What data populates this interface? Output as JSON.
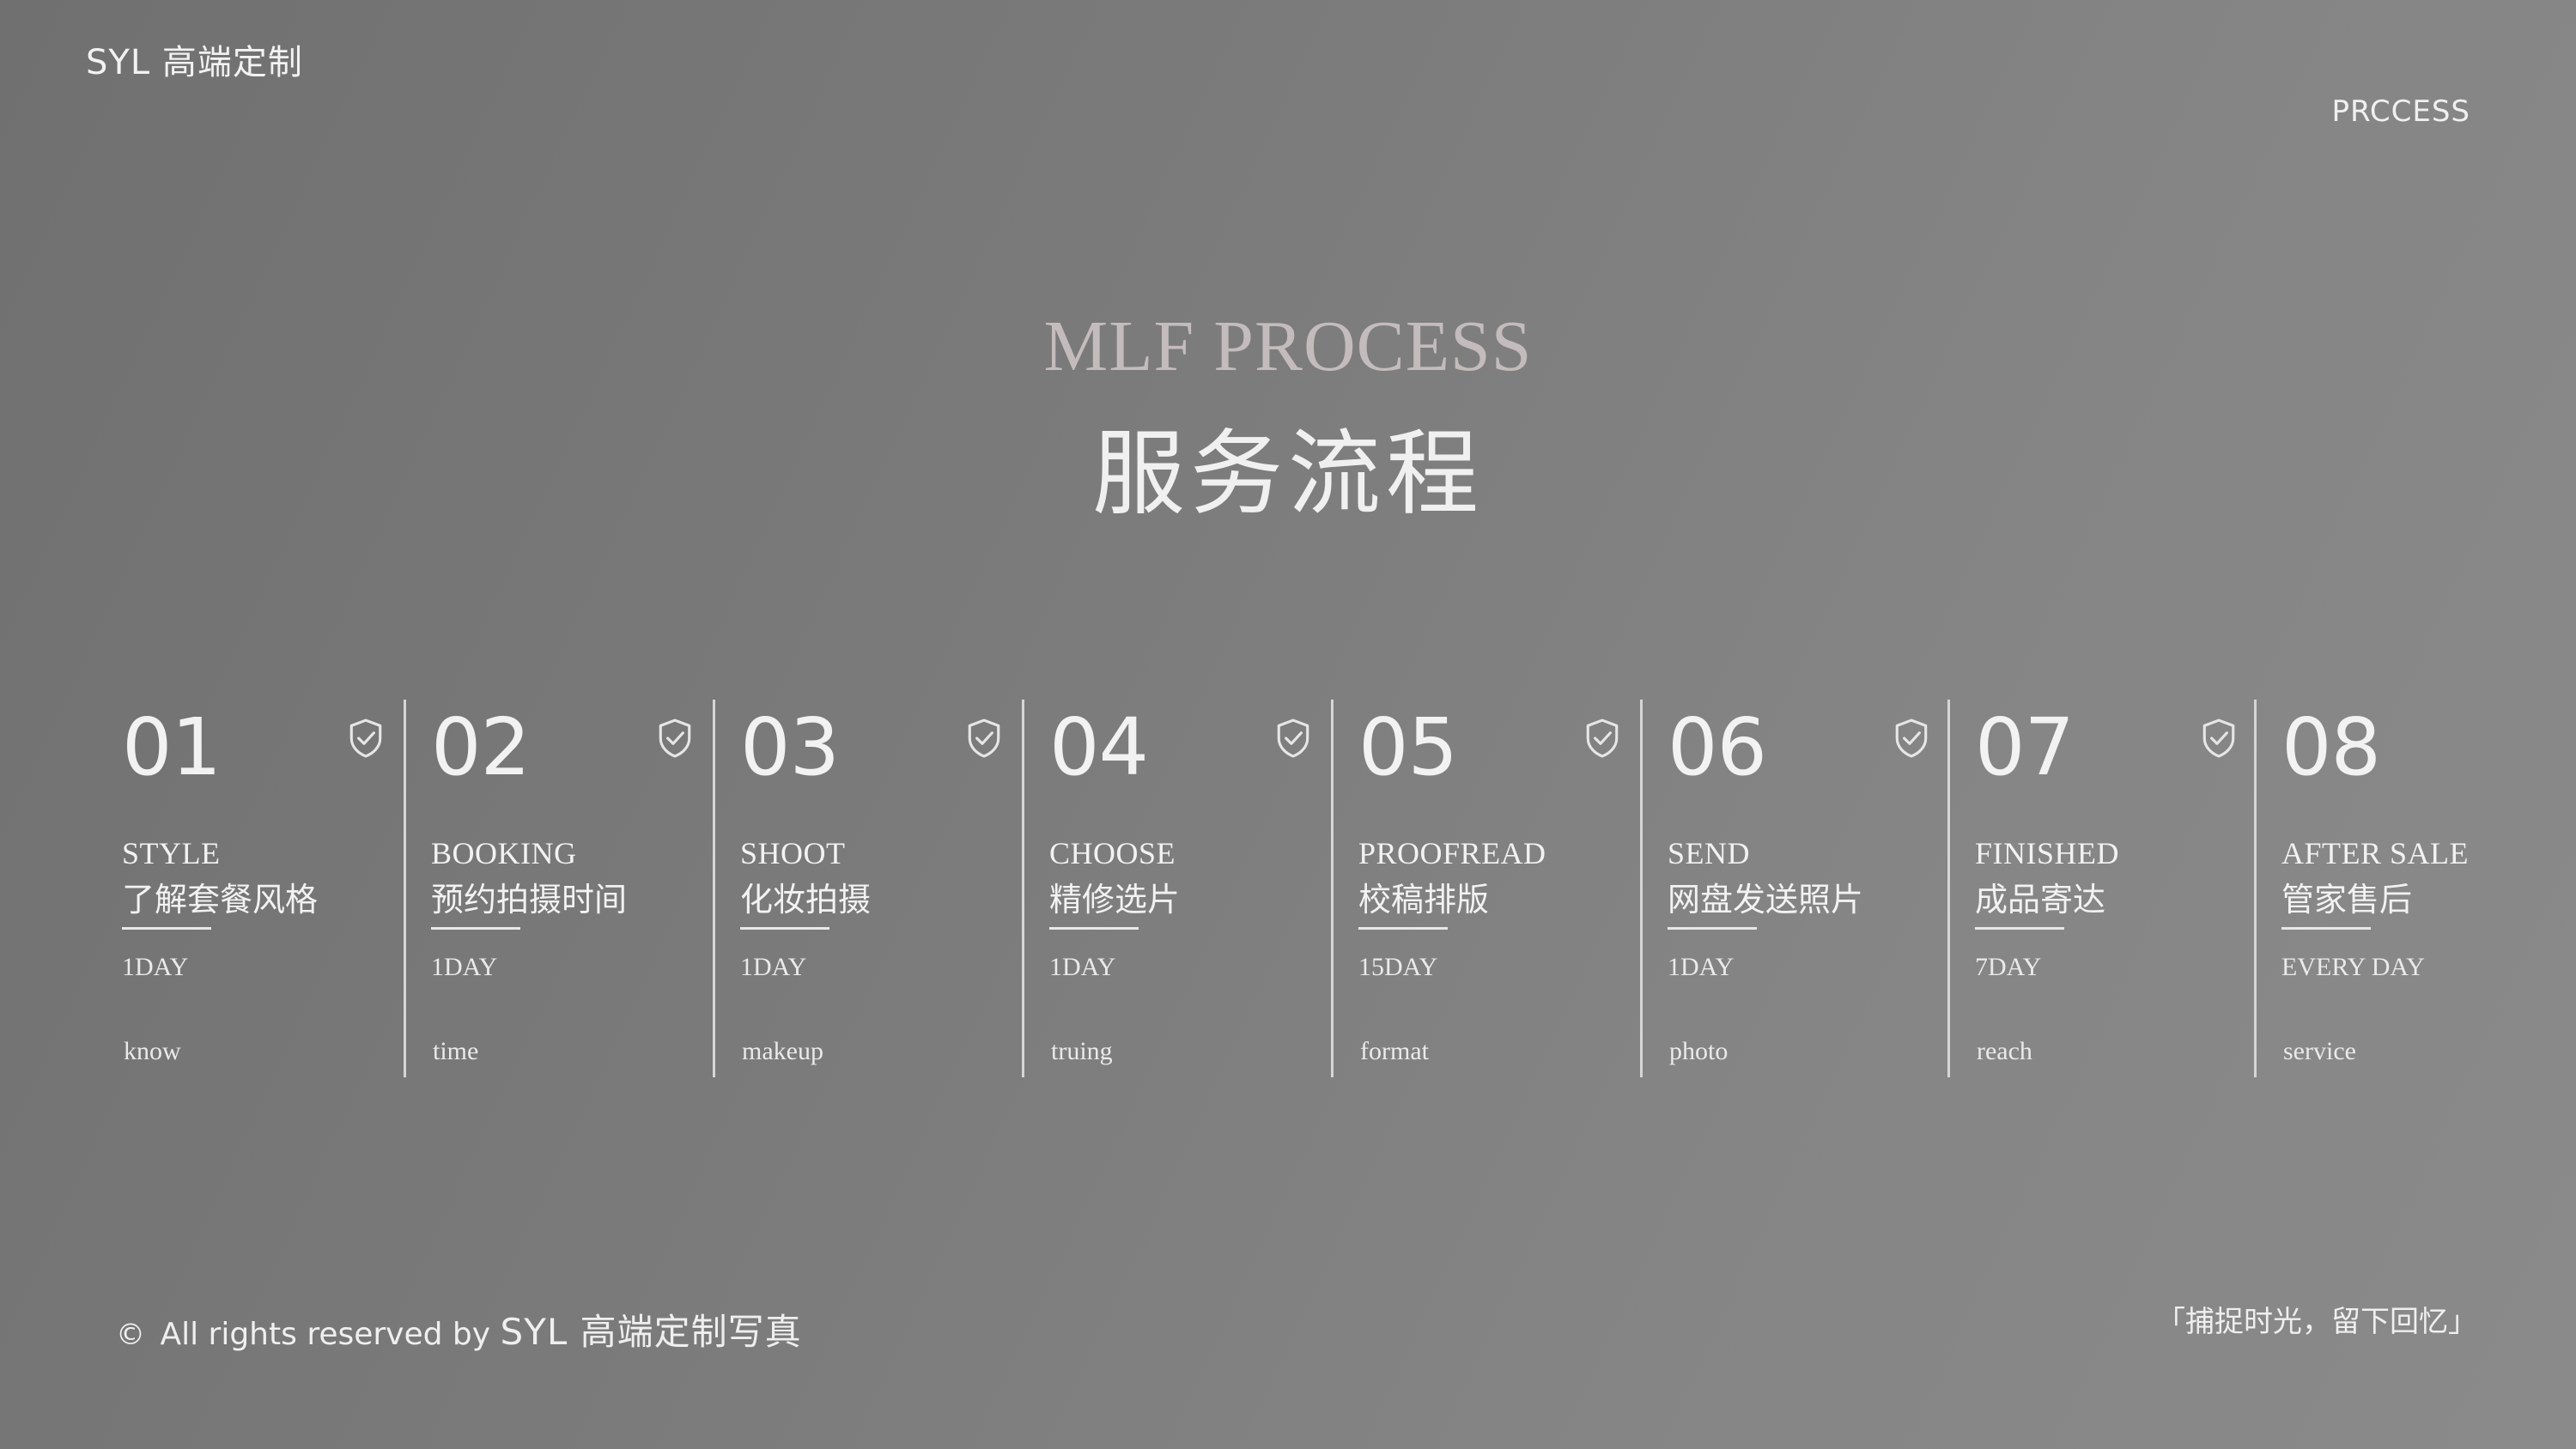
{
  "header": {
    "brand": "SYL 高端定制",
    "right_label": "PRCCESS"
  },
  "hero": {
    "title_en": "MLF PROCESS",
    "title_cn": "服务流程"
  },
  "steps": [
    {
      "num": "01",
      "en": "STYLE",
      "cn": "了解套餐风格",
      "days": "1DAY",
      "word": "know",
      "icon": "shield-check-icon"
    },
    {
      "num": "02",
      "en": "BOOKING",
      "cn": "预约拍摄时间",
      "days": "1DAY",
      "word": "time",
      "icon": "shield-check-icon"
    },
    {
      "num": "03",
      "en": "SHOOT",
      "cn": "化妆拍摄",
      "days": "1DAY",
      "word": "makeup",
      "icon": "shield-check-icon"
    },
    {
      "num": "04",
      "en": "CHOOSE",
      "cn": "精修选片",
      "days": "1DAY",
      "word": "truing",
      "icon": "shield-check-icon"
    },
    {
      "num": "05",
      "en": "PROOFREAD",
      "cn": "校稿排版",
      "days": "15DAY",
      "word": "format",
      "icon": "shield-check-icon"
    },
    {
      "num": "06",
      "en": "SEND",
      "cn": "网盘发送照片",
      "days": "1DAY",
      "word": "photo",
      "icon": "shield-check-icon"
    },
    {
      "num": "07",
      "en": "FINISHED",
      "cn": "成品寄达",
      "days": "7DAY",
      "word": "reach",
      "icon": "shield-check-icon"
    },
    {
      "num": "08",
      "en": "AFTER SALE",
      "cn": "管家售后",
      "days": "EVERY DAY",
      "word": "service"
    }
  ],
  "footer": {
    "copyright_symbol": "©",
    "rights_text": "All rights reserved by",
    "brand": "SYL 高端定制写真",
    "slogan": "「捕捉时光，留下回忆」"
  },
  "colors": {
    "background_start": "#707070",
    "background_end": "#8a8a8a",
    "title_en": "#c4bcbc",
    "text": "#f2f2f2"
  }
}
